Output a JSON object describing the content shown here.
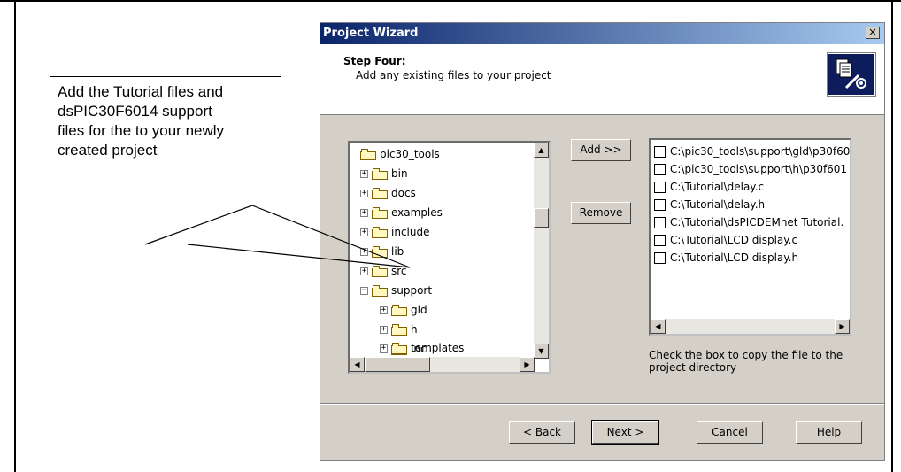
{
  "callout": {
    "lines": [
      "Add the Tutorial files and",
      "dsPIC30F6014 support",
      "files for the to your newly",
      "created project"
    ]
  },
  "dialog": {
    "title": "Project Wizard",
    "close_label": "×",
    "step_title": "Step Four:",
    "step_desc": "Add any existing files to your project",
    "icon": "wizard-icon",
    "tree": {
      "items": [
        {
          "label": "pic30_tools",
          "expander": ""
        },
        {
          "label": "bin",
          "expander": "+"
        },
        {
          "label": "docs",
          "expander": "+"
        },
        {
          "label": "examples",
          "expander": "+"
        },
        {
          "label": "include",
          "expander": "+"
        },
        {
          "label": "lib",
          "expander": "+"
        },
        {
          "label": "src",
          "expander": "+"
        },
        {
          "label": "support",
          "expander": "−"
        },
        {
          "label": "gld",
          "expander": "+"
        },
        {
          "label": "h",
          "expander": "+"
        },
        {
          "label": "inc",
          "expander": "+"
        },
        {
          "label": "templates",
          "expander": "+"
        }
      ]
    },
    "buttons": {
      "add": "Add >>",
      "remove": "Remove",
      "back": "< Back",
      "next": "Next >",
      "cancel": "Cancel",
      "help": "Help"
    },
    "files": [
      "C:\\pic30_tools\\support\\gld\\p30f60",
      "C:\\pic30_tools\\support\\h\\p30f601",
      "C:\\Tutorial\\delay.c",
      "C:\\Tutorial\\delay.h",
      "C:\\Tutorial\\dsPICDEMnet Tutorial.",
      "C:\\Tutorial\\LCD display.c",
      "C:\\Tutorial\\LCD display.h"
    ],
    "hint": "Check the box to copy the file to the project directory"
  }
}
